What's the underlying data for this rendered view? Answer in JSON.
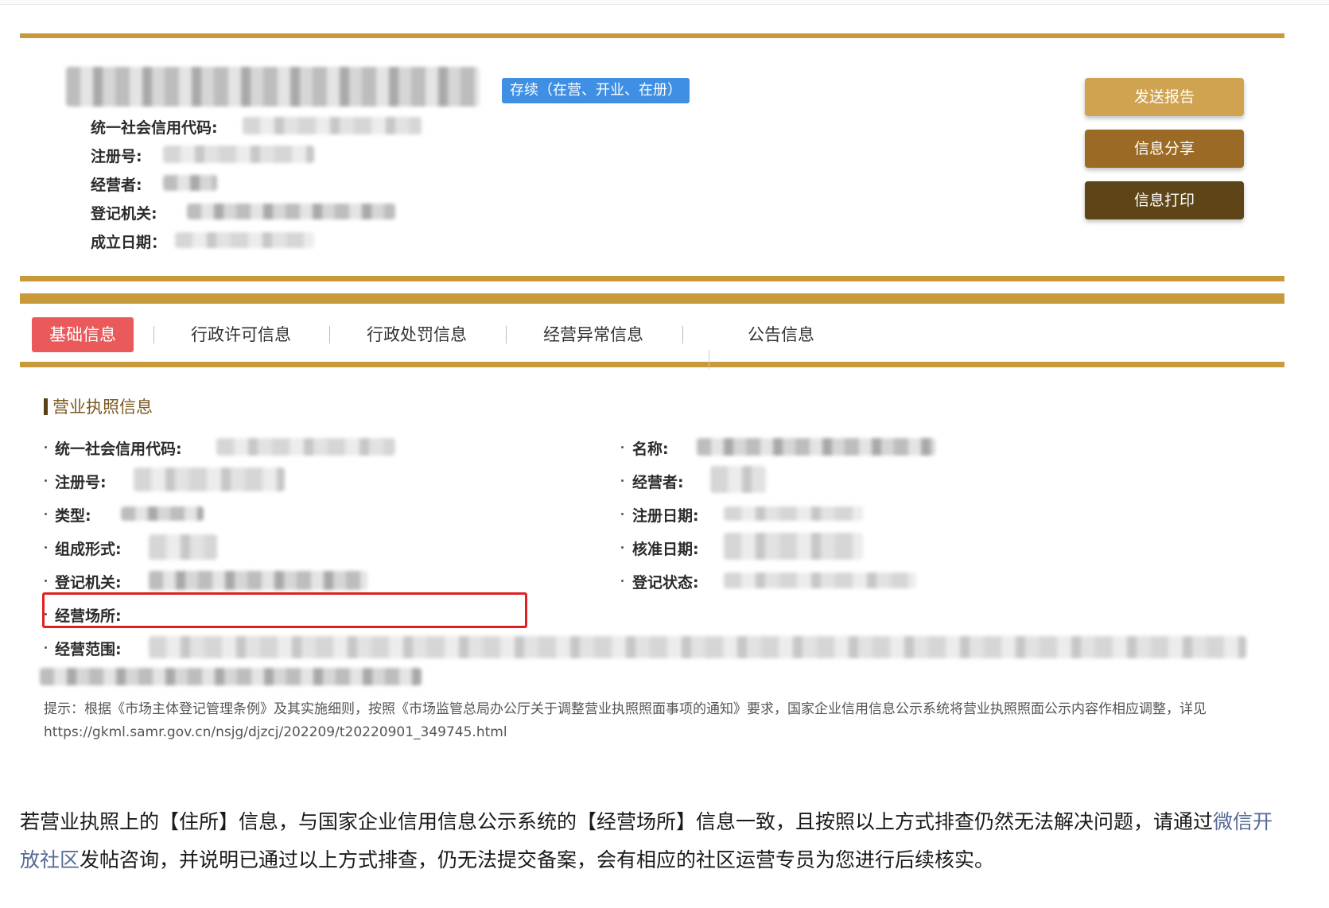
{
  "company_header": {
    "status_badge": "存续（在营、开业、在册）",
    "fields": [
      {
        "label": "统一社会信用代码:"
      },
      {
        "label": "注册号:"
      },
      {
        "label": "经营者:"
      },
      {
        "label": "登记机关:"
      },
      {
        "label": "成立日期："
      }
    ]
  },
  "actions": {
    "send_report": "发送报告",
    "share": "信息分享",
    "print": "信息打印",
    "colors": {
      "send_report": "#cfa350",
      "share": "#9b6a24",
      "print": "#5e4518"
    }
  },
  "tabs": [
    {
      "label": "基础信息",
      "active": true
    },
    {
      "label": "行政许可信息",
      "active": false
    },
    {
      "label": "行政处罚信息",
      "active": false
    },
    {
      "label": "经营异常信息",
      "active": false
    },
    {
      "label": "公告信息",
      "active": false
    }
  ],
  "license_section": {
    "title": "营业执照信息",
    "left_fields": [
      {
        "label": "统一社会信用代码:"
      },
      {
        "label": "注册号:"
      },
      {
        "label": "类型:"
      },
      {
        "label": "组成形式:"
      },
      {
        "label": "登记机关:"
      },
      {
        "label": "经营场所:"
      },
      {
        "label": "经营范围:"
      }
    ],
    "right_fields": [
      {
        "label": "名称:"
      },
      {
        "label": "经营者:"
      },
      {
        "label": "注册日期:"
      },
      {
        "label": "核准日期:"
      },
      {
        "label": "登记状态:"
      }
    ],
    "note": "提示：根据《市场主体登记管理条例》及其实施细则，按照《市场监管总局办公厅关于调整营业执照照面事项的通知》要求，国家企业信用信息公示系统将营业执照照面公示内容作相应调整，详见https://gkml.samr.gov.cn/nsjg/djzcj/202209/t20220901_349745.html"
  },
  "article": {
    "text_before": "若营业执照上的【住所】信息，与国家企业信用信息公示系统的【经营场所】信息一致，且按照以上方式排查仍然无法解决问题，请通过",
    "link": "微信开放社区",
    "text_after": "发帖咨询，并说明已通过以上方式排查，仍无法提交备案，会有相应的社区运营专员为您进行后续核实。"
  },
  "colors": {
    "gold": "#c99a3c",
    "active_tab": "#ea5a5a",
    "badge": "#3f8fe4",
    "highlight": "#e02020",
    "link": "#576b95"
  }
}
